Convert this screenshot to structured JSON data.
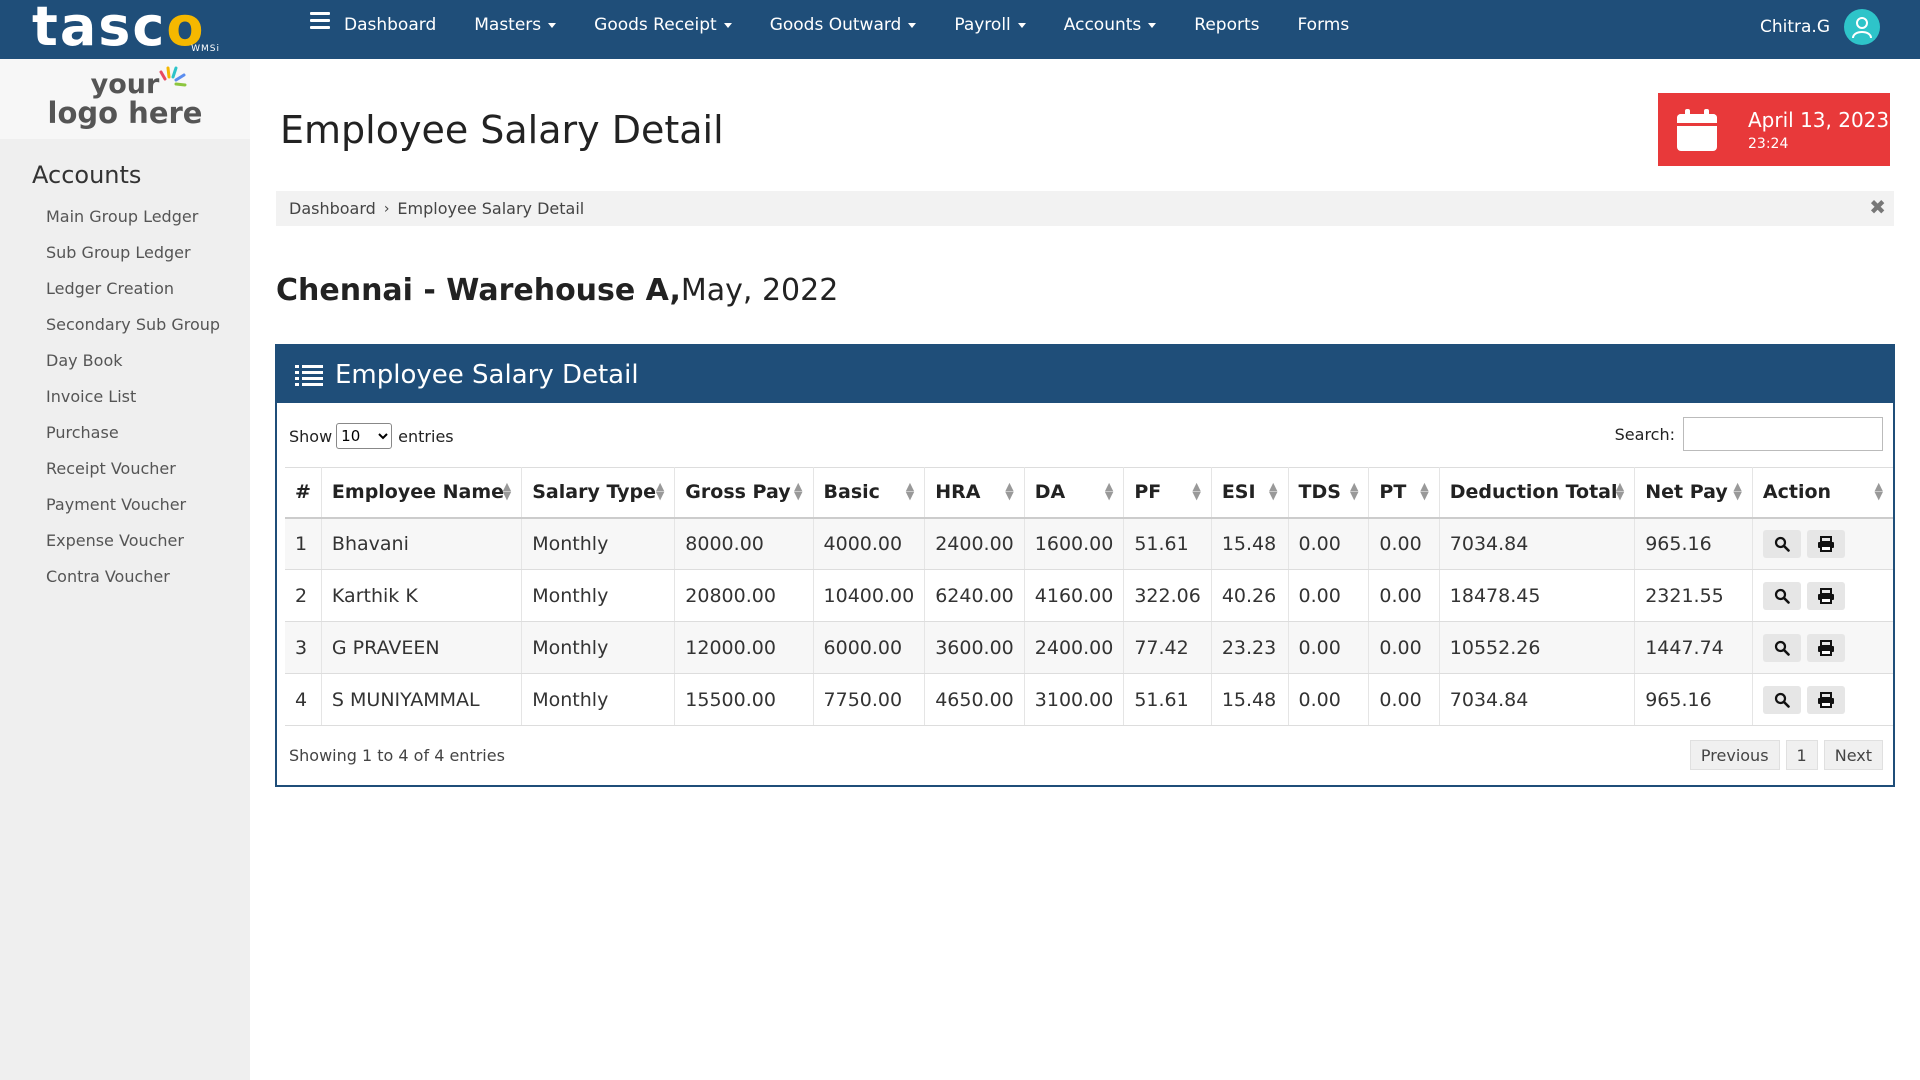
{
  "brand": {
    "name_pre": "tasc",
    "name_o": "o",
    "sub": "WMSi"
  },
  "nav": {
    "items": [
      {
        "label": "Dashboard",
        "dropdown": false
      },
      {
        "label": "Masters",
        "dropdown": true
      },
      {
        "label": "Goods Receipt",
        "dropdown": true
      },
      {
        "label": "Goods Outward",
        "dropdown": true
      },
      {
        "label": "Payroll",
        "dropdown": true
      },
      {
        "label": "Accounts",
        "dropdown": true
      },
      {
        "label": "Reports",
        "dropdown": false
      },
      {
        "label": "Forms",
        "dropdown": false
      }
    ],
    "user": "Chitra.G"
  },
  "sidebar": {
    "logo_line1": "your",
    "logo_line2": "logo here",
    "heading": "Accounts",
    "items": [
      "Main Group Ledger",
      "Sub Group Ledger",
      "Ledger Creation",
      "Secondary Sub Group",
      "Day Book",
      "Invoice List",
      "Purchase",
      "Receipt Voucher",
      "Payment Voucher",
      "Expense Voucher",
      "Contra Voucher"
    ]
  },
  "page": {
    "title": "Employee Salary Detail",
    "date": "April 13, 2023",
    "time": "23:24",
    "breadcrumb": [
      "Dashboard",
      "Employee Salary Detail"
    ],
    "location_bold": "Chennai - Warehouse A,",
    "location_period": "May, 2022"
  },
  "panel": {
    "title": "Employee Salary Detail",
    "show_label": "Show",
    "entries_label": "entries",
    "page_size": "10",
    "search_label": "Search:",
    "search_value": "",
    "info": "Showing 1 to 4 of 4 entries",
    "prev": "Previous",
    "page": "1",
    "next": "Next"
  },
  "table": {
    "columns": [
      "#",
      "Employee Name",
      "Salary Type",
      "Gross Pay",
      "Basic",
      "HRA",
      "DA",
      "PF",
      "ESI",
      "TDS",
      "PT",
      "Deduction Total",
      "Net Pay",
      "Action"
    ],
    "rows": [
      [
        "1",
        "Bhavani",
        "Monthly",
        "8000.00",
        "4000.00",
        "2400.00",
        "1600.00",
        "51.61",
        "15.48",
        "0.00",
        "0.00",
        "7034.84",
        "965.16"
      ],
      [
        "2",
        "Karthik K",
        "Monthly",
        "20800.00",
        "10400.00",
        "6240.00",
        "4160.00",
        "322.06",
        "40.26",
        "0.00",
        "0.00",
        "18478.45",
        "2321.55"
      ],
      [
        "3",
        "G PRAVEEN",
        "Monthly",
        "12000.00",
        "6000.00",
        "3600.00",
        "2400.00",
        "77.42",
        "23.23",
        "0.00",
        "0.00",
        "10552.26",
        "1447.74"
      ],
      [
        "4",
        "S MUNIYAMMAL",
        "Monthly",
        "15500.00",
        "7750.00",
        "4650.00",
        "3100.00",
        "51.61",
        "15.48",
        "0.00",
        "0.00",
        "7034.84",
        "965.16"
      ]
    ]
  },
  "colors": {
    "nav": "#1f4e79",
    "date_box": "#e8393a",
    "avatar": "#2ec4c9"
  }
}
